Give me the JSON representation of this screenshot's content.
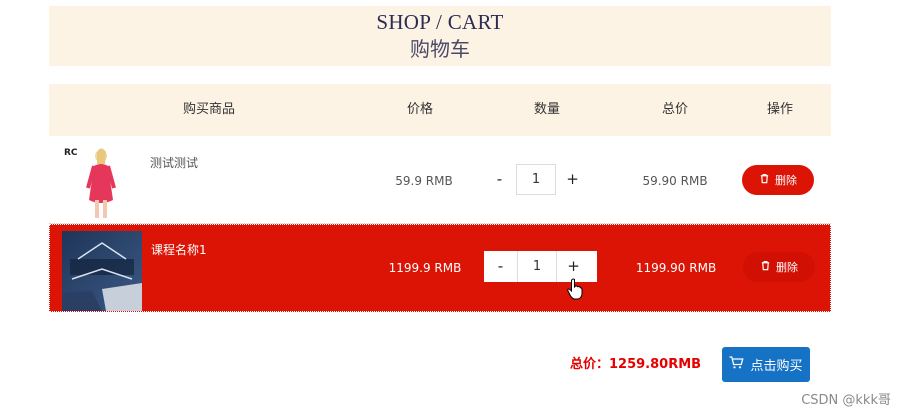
{
  "header": {
    "title_en": "SHOP / CART",
    "title_cn": "购物车"
  },
  "table": {
    "columns": [
      "购买商品",
      "价格",
      "数量",
      "总价",
      "操作"
    ]
  },
  "items": [
    {
      "name": "测试测试",
      "price": "59.9 RMB",
      "quantity": "1",
      "total": "59.90 RMB",
      "delete_label": "删除",
      "logo_text": "RC"
    },
    {
      "name": "课程名称1",
      "price": "1199.9 RMB",
      "quantity": "1",
      "total": "1199.90 RMB",
      "delete_label": "删除"
    }
  ],
  "qty_controls": {
    "minus": "-",
    "plus": "+"
  },
  "summary": {
    "text": "总价：1259.80RMB"
  },
  "buy_button": {
    "label": "点击购买"
  },
  "watermark": "CSDN @kkk哥",
  "colors": {
    "header_bg": "#fdf3e5",
    "selected_row": "#dc1405",
    "delete_button": "#dc1405",
    "buy_button": "#1572c4",
    "total_text": "#e60000"
  }
}
